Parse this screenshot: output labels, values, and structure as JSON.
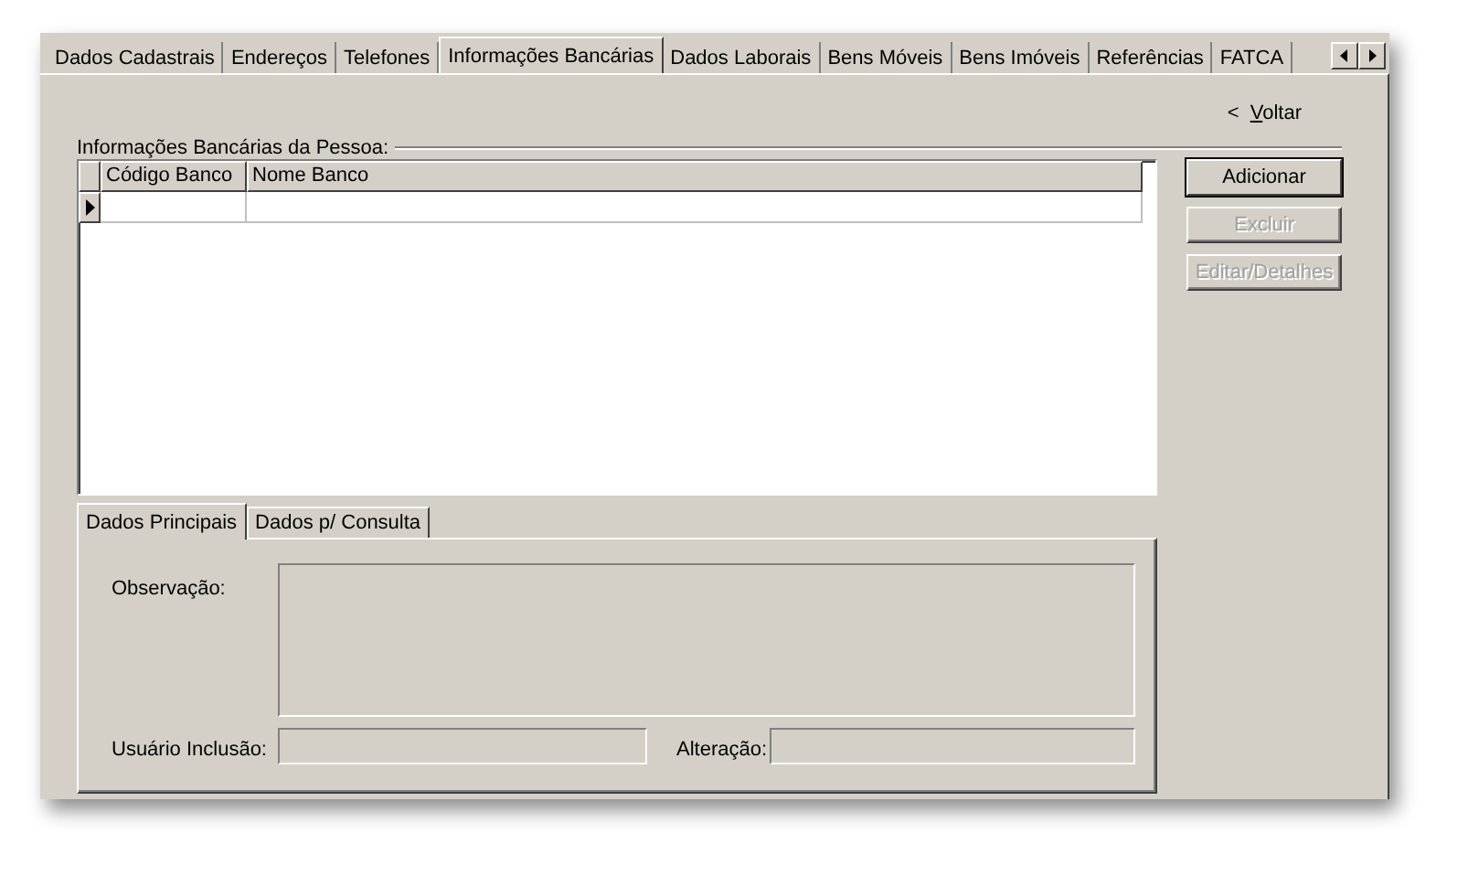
{
  "tabs": [
    {
      "label": "Dados Cadastrais",
      "selected": false
    },
    {
      "label": "Endereços",
      "selected": false
    },
    {
      "label": "Telefones",
      "selected": false
    },
    {
      "label": "Informações Bancárias",
      "selected": true
    },
    {
      "label": "Dados Laborais",
      "selected": false
    },
    {
      "label": "Bens Móveis",
      "selected": false
    },
    {
      "label": "Bens Imóveis",
      "selected": false
    },
    {
      "label": "Referências",
      "selected": false
    },
    {
      "label": "FATCA",
      "selected": false
    }
  ],
  "back_link": {
    "arrow": "<",
    "label": "Voltar"
  },
  "group_title": "Informações Bancárias da Pessoa:",
  "grid": {
    "columns": [
      "Código Banco",
      "Nome Banco"
    ],
    "rows": [
      {
        "cells": [
          "",
          ""
        ],
        "selected": true
      }
    ]
  },
  "buttons": [
    {
      "label": "Adicionar",
      "disabled": false
    },
    {
      "label": "Excluir",
      "disabled": true
    },
    {
      "label": "Editar/Detalhes",
      "disabled": true
    }
  ],
  "detail_tabs": [
    {
      "label": "Dados Principais",
      "selected": true
    },
    {
      "label": "Dados p/ Consulta",
      "selected": false
    }
  ],
  "fields": {
    "observacao": "Observação:",
    "usuario_inclusao": "Usuário Inclusão:",
    "alteracao": "Alteração:"
  }
}
